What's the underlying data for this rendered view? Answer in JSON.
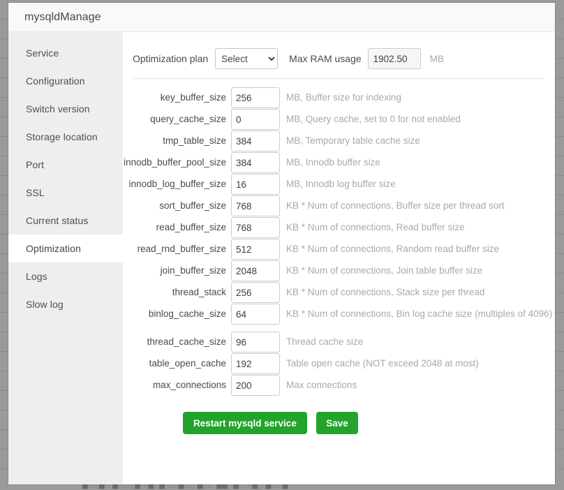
{
  "window": {
    "title": "mysqldManage"
  },
  "sidebar": {
    "items": [
      {
        "label": "Service",
        "active": false
      },
      {
        "label": "Configuration",
        "active": false
      },
      {
        "label": "Switch version",
        "active": false
      },
      {
        "label": "Storage location",
        "active": false
      },
      {
        "label": "Port",
        "active": false
      },
      {
        "label": "SSL",
        "active": false
      },
      {
        "label": "Current status",
        "active": false
      },
      {
        "label": "Optimization",
        "active": true
      },
      {
        "label": "Logs",
        "active": false
      },
      {
        "label": "Slow log",
        "active": false
      }
    ]
  },
  "main": {
    "plan": {
      "label": "Optimization plan",
      "selected": "Select",
      "options": [
        "Select"
      ]
    },
    "ram": {
      "label": "Max RAM usage",
      "value": "1902.50",
      "unit": "MB"
    },
    "settings": [
      {
        "name": "key_buffer_size",
        "value": "256",
        "desc": "MB, Buffer size for indexing"
      },
      {
        "name": "query_cache_size",
        "value": "0",
        "desc": "MB, Query cache, set to 0 for not enabled"
      },
      {
        "name": "tmp_table_size",
        "value": "384",
        "desc": "MB, Temporary table cache size"
      },
      {
        "name": "innodb_buffer_pool_size",
        "value": "384",
        "desc": "MB, Innodb buffer size"
      },
      {
        "name": "innodb_log_buffer_size",
        "value": "16",
        "desc": "MB, Innodb log buffer size"
      },
      {
        "name": "sort_buffer_size",
        "value": "768",
        "desc": "KB * Num of connections, Buffer size per thread sort"
      },
      {
        "name": "read_buffer_size",
        "value": "768",
        "desc": "KB * Num of connections, Read buffer size"
      },
      {
        "name": "read_rnd_buffer_size",
        "value": "512",
        "desc": "KB * Num of connections, Random read buffer size"
      },
      {
        "name": "join_buffer_size",
        "value": "2048",
        "desc": "KB * Num of connections, Join table buffer size"
      },
      {
        "name": "thread_stack",
        "value": "256",
        "desc": "KB * Num of connections, Stack size per thread"
      },
      {
        "name": "binlog_cache_size",
        "value": "64",
        "desc": "KB * Num of connections, Bin log cache size (multiples of 4096)"
      },
      {
        "name": "thread_cache_size",
        "value": "96",
        "desc": "Thread cache size"
      },
      {
        "name": "table_open_cache",
        "value": "192",
        "desc": "Table open cache (NOT exceed 2048 at most)"
      },
      {
        "name": "max_connections",
        "value": "200",
        "desc": "Max connections"
      }
    ],
    "buttons": {
      "restart": "Restart mysqld service",
      "save": "Save"
    }
  },
  "colors": {
    "button_green": "#22a32b",
    "sidebar_bg": "#eeeeee",
    "desc_gray": "#a9a9a9"
  },
  "background": {
    "cut_off_text": "█░░▄░ ▄░░░▄ ░▄░▄ ░░▄░░ ▄░░ ▄▄░▄░ ░▄░ ▄░░▄"
  }
}
